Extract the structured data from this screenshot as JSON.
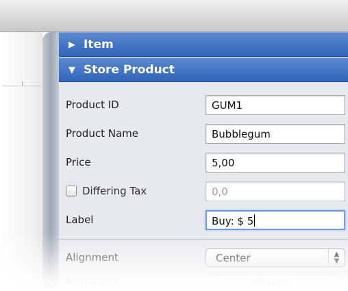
{
  "sections": {
    "item": {
      "label": "Item",
      "icon": "disclosure-collapsed-icon"
    },
    "store_product": {
      "label": "Store Product",
      "icon": "disclosure-expanded-icon"
    }
  },
  "fields": {
    "product_id": {
      "label": "Product ID",
      "value": "GUM1"
    },
    "product_name": {
      "label": "Product Name",
      "value": "Bubblegum"
    },
    "price": {
      "label": "Price",
      "value": "5,00"
    },
    "differing_tax": {
      "label": "Differing Tax",
      "value": "0,0",
      "checked": false
    },
    "label": {
      "label": "Label",
      "value": "Buy: $ 5"
    }
  },
  "alignment": {
    "label": "Alignment",
    "selected": "Center",
    "icon": "up-down-stepper-icon"
  },
  "font_style": {
    "label": "Font Style",
    "button": "Choose..."
  },
  "colors": {
    "section_header": "#3a6fc4",
    "panel": "#e6e9ee",
    "focus_ring": "#6c9be6"
  }
}
